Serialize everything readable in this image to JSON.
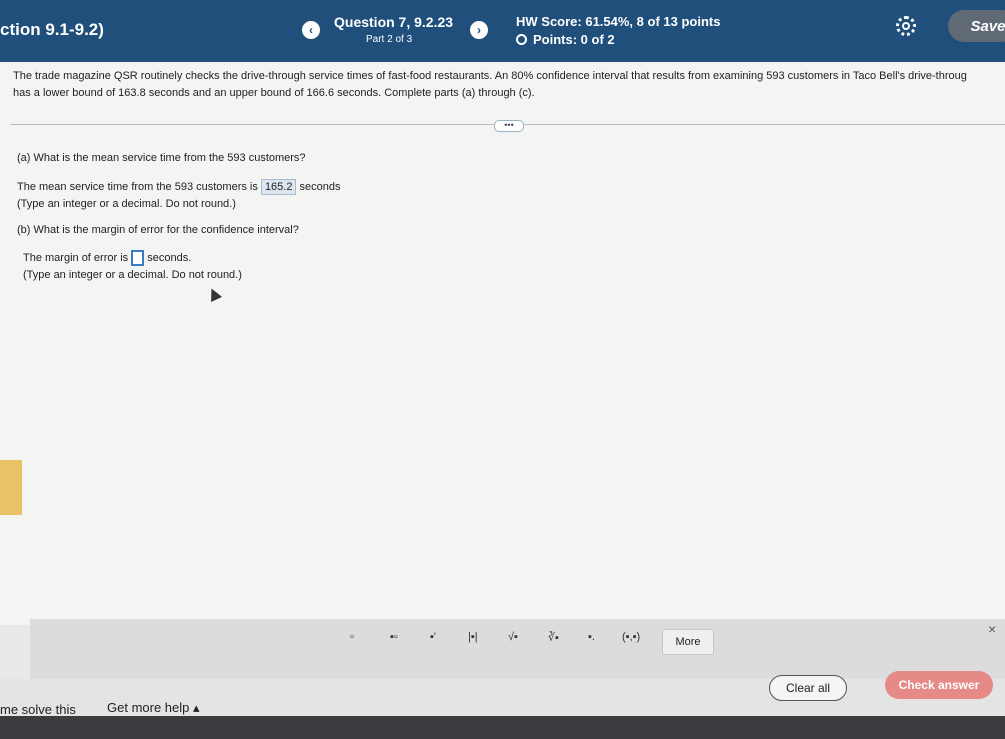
{
  "header": {
    "section": "ction 9.1-9.2)",
    "question": "Question 7, 9.2.23",
    "part": "Part 2 of 3",
    "hw_score": "HW Score: 61.54%, 8 of 13 points",
    "points": "Points: 0 of 2",
    "save_label": "Save",
    "prev_glyph": "‹",
    "next_glyph": "›",
    "settings_icon": "gear-icon"
  },
  "problem": {
    "stem_line1": "The trade magazine QSR routinely checks the drive-through service times of fast-food restaurants. An 80% confidence interval that results from examining 593 customers in Taco Bell's drive-throug",
    "stem_line2": "has a lower bound of 163.8 seconds and an upper bound of 166.6 seconds. Complete parts (a) through (c).",
    "dots": "•••"
  },
  "part_a": {
    "question": "(a) What is the mean service time from the 593 customers?",
    "answer_prefix": "The mean service time from the 593 customers is",
    "answer_value": "165.2",
    "answer_suffix": "seconds",
    "hint": "(Type an integer or a decimal. Do not round.)"
  },
  "part_b": {
    "question": "(b) What is the margin of error for the confidence interval?",
    "answer_prefix": "The margin of error is",
    "answer_suffix": "seconds.",
    "hint": "(Type an integer or a decimal. Do not round.)"
  },
  "toolbar": {
    "buttons": [
      "▫",
      "▪▫",
      "▪'",
      "|▪|",
      "√▪",
      "∛▪",
      "▪.",
      "(▪,▪)"
    ],
    "more_label": "More",
    "close_glyph": "×"
  },
  "footer": {
    "solve_label": "me solve this",
    "help_label": "Get more help ▴",
    "clear_label": "Clear all",
    "check_label": "Check answer"
  }
}
